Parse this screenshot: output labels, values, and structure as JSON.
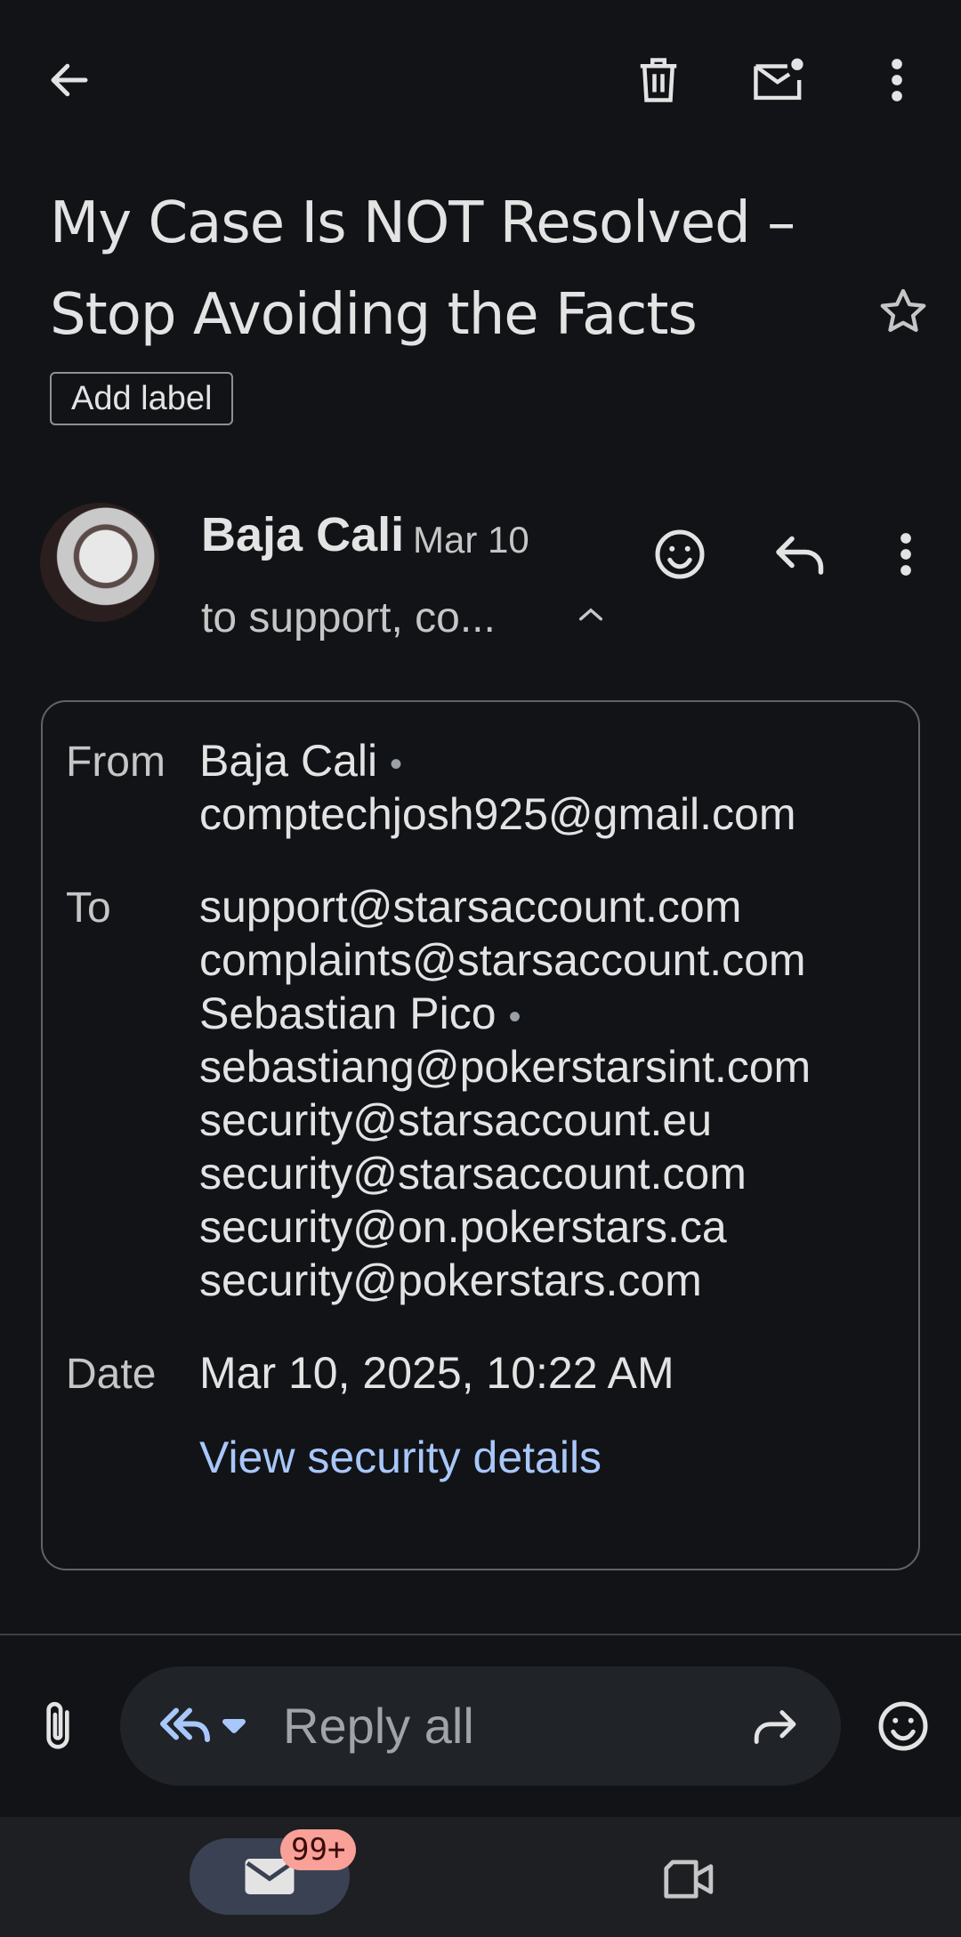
{
  "header": {
    "icons": [
      "back-arrow-icon",
      "delete-icon",
      "mark-unread-icon",
      "more-vert-icon"
    ]
  },
  "email": {
    "subject": "My Case Is NOT Resolved – Stop Avoiding the Facts",
    "add_label": "Add label",
    "sender_name": "Baja Cali",
    "date_short": "Mar 10",
    "recipients_summary": "to support, co..."
  },
  "details": {
    "from_label": "From",
    "from_name": "Baja Cali",
    "from_email": "comptechjosh925@gmail.com",
    "to_label": "To",
    "to_lines": [
      "support@starsaccount.com",
      "complaints@starsaccount.com",
      "Sebastian Pico",
      "sebastiang@pokerstarsint.com",
      "security@starsaccount.eu",
      "security@starsaccount.com",
      "security@on.pokerstars.ca",
      "security@pokerstars.com"
    ],
    "date_label": "Date",
    "date_full": "Mar 10, 2025, 10:22 AM",
    "security_link": "View security details"
  },
  "reply_bar": {
    "placeholder": "Reply all"
  },
  "bottom_nav": {
    "mail_badge": "99+"
  },
  "colors": {
    "background": "#121317",
    "link": "#a8c7fa",
    "badge": "#f9a098"
  }
}
